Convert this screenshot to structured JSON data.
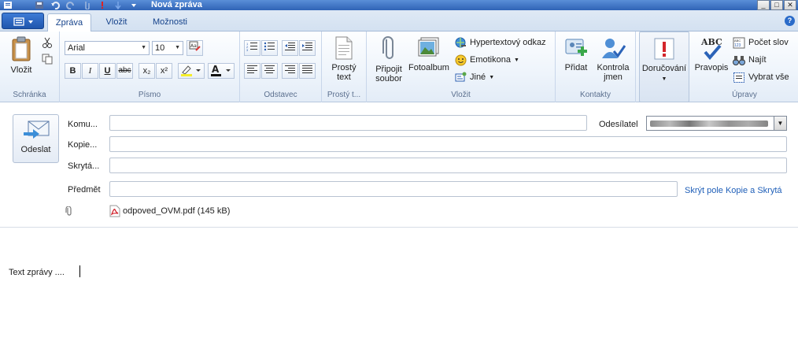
{
  "window": {
    "title": "Nová zpráva"
  },
  "tabs": [
    {
      "label": "Zpráva",
      "active": true
    },
    {
      "label": "Vložit",
      "active": false
    },
    {
      "label": "Možnosti",
      "active": false
    }
  ],
  "ribbon": {
    "clipboard": {
      "label": "Schránka",
      "paste": "Vložit"
    },
    "font": {
      "label": "Písmo",
      "family": "Arial",
      "size": "10",
      "bold": "B",
      "italic": "I",
      "underline": "U",
      "strike": "abc",
      "sub": "x₂",
      "sup": "x²",
      "color_glyph": "A"
    },
    "paragraph": {
      "label": "Odstavec"
    },
    "plaintext": {
      "label": "Prostý t...",
      "button_line1": "Prostý",
      "button_line2": "text"
    },
    "insert": {
      "label": "Vložit",
      "attach_line1": "Připojit",
      "attach_line2": "soubor",
      "photoalbum": "Fotoalbum",
      "hyperlink": "Hypertextový odkaz",
      "emoticon": "Emotikona",
      "other": "Jiné"
    },
    "contacts": {
      "label": "Kontakty",
      "add": "Přidat",
      "check_line1": "Kontrola",
      "check_line2": "jmen"
    },
    "delivery": {
      "label": "Doručování"
    },
    "editing": {
      "label": "Úpravy",
      "spelling": "Pravopis",
      "spelling_glyph": "ABC",
      "wordcount": "Počet slov",
      "find": "Najít",
      "selectall": "Vybrat vše"
    }
  },
  "compose": {
    "send": "Odeslat",
    "to_label": "Komu...",
    "cc_label": "Kopie...",
    "bcc_label": "Skrytá...",
    "subject_label": "Předmět",
    "sender_label": "Odesílatel",
    "hide_link": "Skrýt pole Kopie a Skrytá",
    "attachment": "odpoved_OVM.pdf (145 kB)"
  },
  "body": {
    "text": "Text zprávy ...."
  },
  "colors": {
    "accent": "#2f63b6",
    "link": "#1f5fb8",
    "ribbon": "#eef4fb"
  }
}
